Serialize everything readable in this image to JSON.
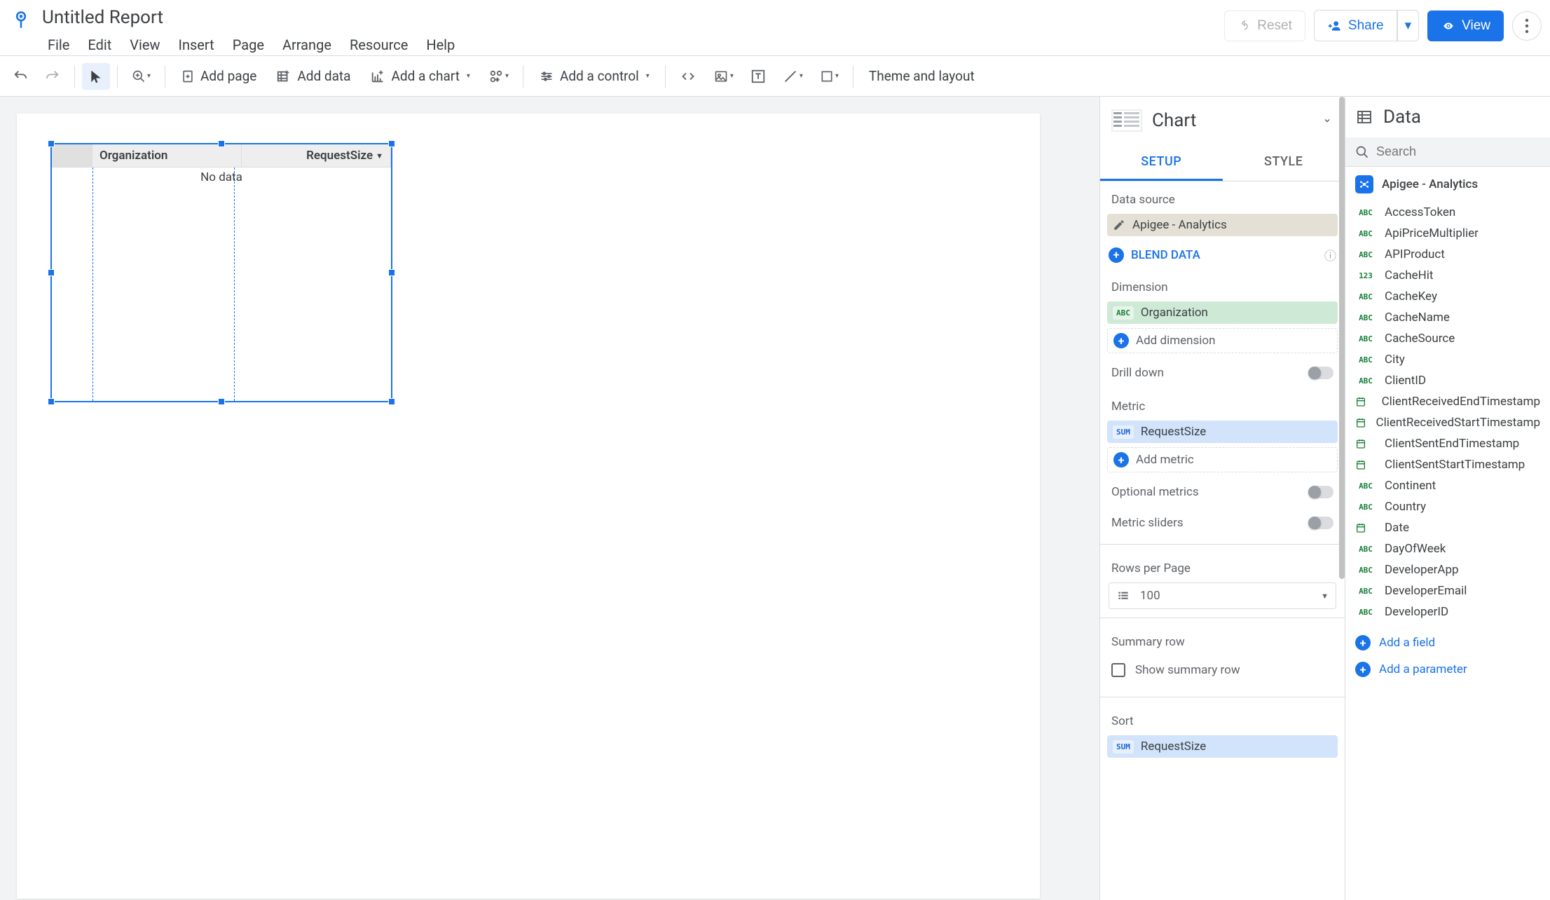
{
  "header": {
    "title": "Untitled Report",
    "menus": [
      "File",
      "Edit",
      "View",
      "Insert",
      "Page",
      "Arrange",
      "Resource",
      "Help"
    ],
    "reset": "Reset",
    "share": "Share",
    "view": "View"
  },
  "toolbar": {
    "addPage": "Add page",
    "addData": "Add data",
    "addChart": "Add a chart",
    "addControl": "Add a control",
    "themeLayout": "Theme and layout"
  },
  "canvas": {
    "table": {
      "dimHeader": "Organization",
      "metricHeader": "RequestSize",
      "noData": "No data"
    }
  },
  "chartPanel": {
    "title": "Chart",
    "tabs": {
      "setup": "SETUP",
      "style": "STYLE"
    },
    "dataSourceLabel": "Data source",
    "dataSourceName": "Apigee - Analytics",
    "blendData": "BLEND DATA",
    "dimensionLabel": "Dimension",
    "dimensionValue": "Organization",
    "addDimension": "Add dimension",
    "drillDown": "Drill down",
    "metricLabel": "Metric",
    "metricAgg": "SUM",
    "metricValue": "RequestSize",
    "addMetric": "Add metric",
    "optionalMetrics": "Optional metrics",
    "metricSliders": "Metric sliders",
    "rowsPerPage": "Rows per Page",
    "rowsValue": "100",
    "summaryRowLabel": "Summary row",
    "showSummaryRow": "Show summary row",
    "sortLabel": "Sort",
    "sortValue": "RequestSize"
  },
  "dataPanel": {
    "title": "Data",
    "searchPlaceholder": "Search",
    "sourceName": "Apigee - Analytics",
    "fields": [
      {
        "type": "abc",
        "name": "AccessToken"
      },
      {
        "type": "abc",
        "name": "ApiPriceMultiplier"
      },
      {
        "type": "abc",
        "name": "APIProduct"
      },
      {
        "type": "123",
        "name": "CacheHit"
      },
      {
        "type": "abc",
        "name": "CacheKey"
      },
      {
        "type": "abc",
        "name": "CacheName"
      },
      {
        "type": "abc",
        "name": "CacheSource"
      },
      {
        "type": "abc",
        "name": "City"
      },
      {
        "type": "abc",
        "name": "ClientID"
      },
      {
        "type": "date",
        "name": "ClientReceivedEndTimestamp"
      },
      {
        "type": "date",
        "name": "ClientReceivedStartTimestamp"
      },
      {
        "type": "date",
        "name": "ClientSentEndTimestamp"
      },
      {
        "type": "date",
        "name": "ClientSentStartTimestamp"
      },
      {
        "type": "abc",
        "name": "Continent"
      },
      {
        "type": "abc",
        "name": "Country"
      },
      {
        "type": "date",
        "name": "Date"
      },
      {
        "type": "abc",
        "name": "DayOfWeek"
      },
      {
        "type": "abc",
        "name": "DeveloperApp"
      },
      {
        "type": "abc",
        "name": "DeveloperEmail"
      },
      {
        "type": "abc",
        "name": "DeveloperID"
      }
    ],
    "addField": "Add a field",
    "addParameter": "Add a parameter"
  }
}
